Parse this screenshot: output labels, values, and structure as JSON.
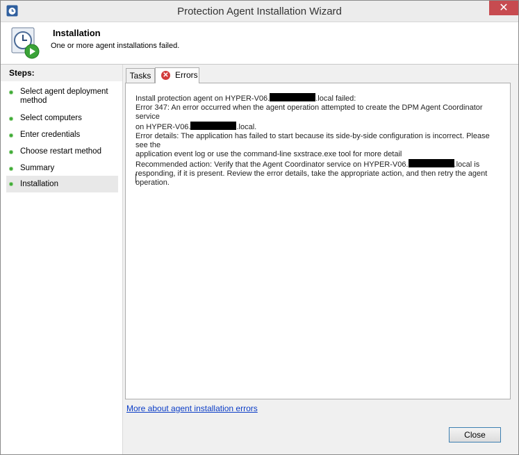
{
  "window": {
    "title": "Protection Agent Installation Wizard",
    "close_glyph": "✕"
  },
  "header": {
    "title": "Installation",
    "subtitle": "One or more agent installations failed.",
    "icon": "clock-play-icon"
  },
  "steps": {
    "title": "Steps:",
    "items": [
      {
        "label": "Select agent deployment method"
      },
      {
        "label": "Select computers"
      },
      {
        "label": "Enter credentials"
      },
      {
        "label": "Choose restart method"
      },
      {
        "label": "Summary"
      },
      {
        "label": "Installation"
      }
    ]
  },
  "tabs": [
    {
      "label": "Tasks"
    },
    {
      "label": "Errors",
      "icon": "error-icon"
    }
  ],
  "errors": {
    "l1a": "Install protection agent on HYPER-V06.",
    "l1b": ".local failed:",
    "l2": "Error 347: An error occurred when the agent operation attempted to create the DPM Agent Coordinator service",
    "l3a": "on HYPER-V06.",
    "l3b": ".local.",
    "l4": "Error details: The application has failed to start because its side-by-side configuration is incorrect. Please see the",
    "l5": "application event log or use the command-line sxstrace.exe tool for more detail",
    "l6a": "Recommended action: Verify that the Agent Coordinator service on HYPER-V06.",
    "l6b": ".local is",
    "l7": "responding, if it is present. Review the error details, take the appropriate action, and then retry the agent",
    "l8": "operation."
  },
  "link": "More about agent installation errors",
  "buttons": {
    "close": "Close"
  }
}
